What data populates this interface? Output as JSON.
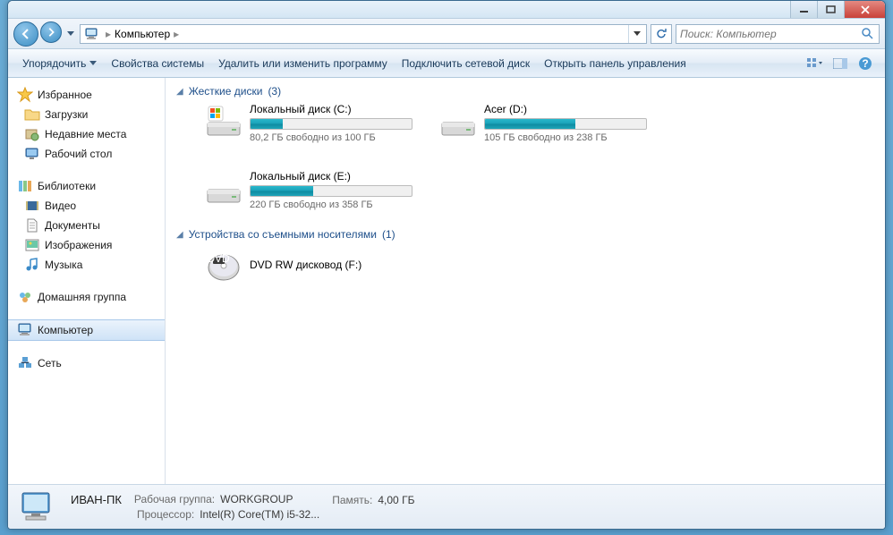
{
  "breadcrumb": {
    "location": "Компьютер"
  },
  "search": {
    "placeholder": "Поиск: Компьютер"
  },
  "toolbar": {
    "organize": "Упорядочить",
    "properties": "Свойства системы",
    "uninstall": "Удалить или изменить программу",
    "map_drive": "Подключить сетевой диск",
    "control_panel": "Открыть панель управления"
  },
  "sidebar": {
    "favorites": {
      "label": "Избранное",
      "items": [
        "Загрузки",
        "Недавние места",
        "Рабочий стол"
      ]
    },
    "libraries": {
      "label": "Библиотеки",
      "items": [
        "Видео",
        "Документы",
        "Изображения",
        "Музыка"
      ]
    },
    "homegroup": "Домашняя группа",
    "computer": "Компьютер",
    "network": "Сеть"
  },
  "groups": {
    "hdd": {
      "label": "Жесткие диски",
      "count": "(3)"
    },
    "removable": {
      "label": "Устройства со съемными носителями",
      "count": "(1)"
    }
  },
  "drives": [
    {
      "name": "Локальный диск (C:)",
      "sub": "80,2 ГБ свободно из 100 ГБ",
      "fill": 20
    },
    {
      "name": "Acer (D:)",
      "sub": "105 ГБ свободно из 238 ГБ",
      "fill": 56
    },
    {
      "name": "Локальный диск (E:)",
      "sub": "220 ГБ свободно из 358 ГБ",
      "fill": 39
    }
  ],
  "devices": [
    {
      "name": "DVD RW дисковод (F:)"
    }
  ],
  "status": {
    "name": "ИВАН-ПК",
    "workgroup_label": "Рабочая группа:",
    "workgroup": "WORKGROUP",
    "cpu_label": "Процессор:",
    "cpu": "Intel(R) Core(TM) i5-32...",
    "mem_label": "Память:",
    "mem": "4,00 ГБ"
  }
}
